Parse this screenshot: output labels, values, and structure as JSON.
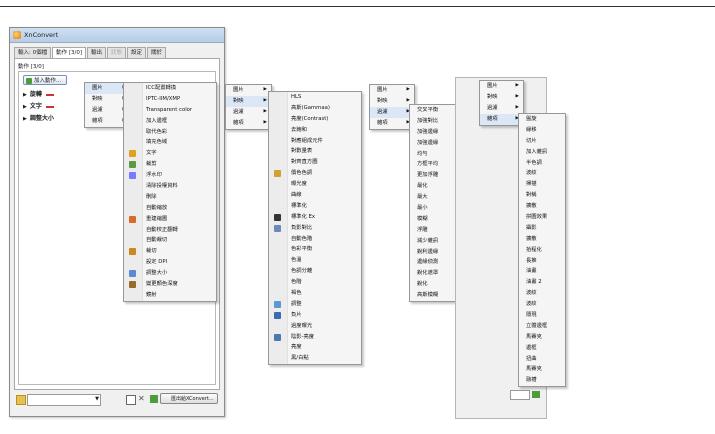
{
  "window": {
    "title": "XnConvert",
    "tabs": [
      "輸入: 0個檔",
      "動作 [3/0]",
      "輸出",
      "狀態",
      "設定",
      "關於"
    ],
    "panel_heading": "動作 [3/0]",
    "add_action_label": "加入動作...",
    "categories": [
      "旋轉",
      "文字",
      "調整大小"
    ],
    "bottom_button_label": "匯出給XConvert..."
  },
  "menus": {
    "level1_left": [
      "圖片",
      "對映",
      "過濾",
      "雜項"
    ],
    "image_actions": [
      "ICC配置轉換",
      "IPTC-IIM/XMP",
      "Transparent color",
      "加入邊框",
      "取代色彩",
      "填充色域",
      "文字",
      "裁剪",
      "浮水印",
      "清除投權資料",
      "刪除",
      "自動縮放",
      "重建縮圖",
      "自動校正翻轉",
      "自動裁切",
      "裁切",
      "設定 DPI",
      "調整大小",
      "變更顏色深度",
      "鏡射"
    ],
    "level1_mid": [
      "圖片",
      "對映",
      "過濾",
      "雜項"
    ],
    "map_actions": [
      "HLS",
      "高斯(Gammaa)",
      "亮度(Contrast)",
      "去飽和",
      "對應組成元件",
      "對數量表",
      "對齊直方圖",
      "價色色調",
      "曝光度",
      "曲線",
      "標準化",
      "標準化 Ex",
      "負影對比",
      "自動色階",
      "色彩平衡",
      "色溫",
      "色調分離",
      "色階",
      "褐色",
      "調整",
      "負片",
      "過度曝光",
      "陰影-亮度",
      "亮度",
      "黑/白點"
    ],
    "level1_right": [
      "圖片",
      "對映",
      "過濾",
      "雜項"
    ],
    "filter_actions": [
      "交叉平衡",
      "加強對比",
      "加強邊緣",
      "加強邊緣",
      "均勻",
      "方框平均",
      "更加浮雕",
      "最化",
      "最大",
      "最小",
      "模糊",
      "浮雕",
      "減少雜訊",
      "銳利邊緣",
      "邊緣偵測",
      "銳化遮罩",
      "銳化",
      "高斯模糊"
    ],
    "level1_far": [
      "圖片",
      "對映",
      "過濾",
      "雜項"
    ],
    "misc_actions": [
      "盤旋",
      "緣移",
      "切片",
      "加入雜訊",
      "半色調",
      "波紋",
      "掃描",
      "對稱",
      "擴散",
      "拼圖效果",
      "攝影",
      "擴散",
      "拾程化",
      "長推",
      "油畫",
      "油畫 2",
      "波紋",
      "波紋",
      "隱現",
      "立體邊框",
      "馬賽克",
      "邊框",
      "扭曲",
      "馬賽克",
      "融槽"
    ]
  },
  "colors": {
    "highlight": "#dbe7f6",
    "menu_bg": "#f5f5f5",
    "category_bar": "#cc3333"
  }
}
